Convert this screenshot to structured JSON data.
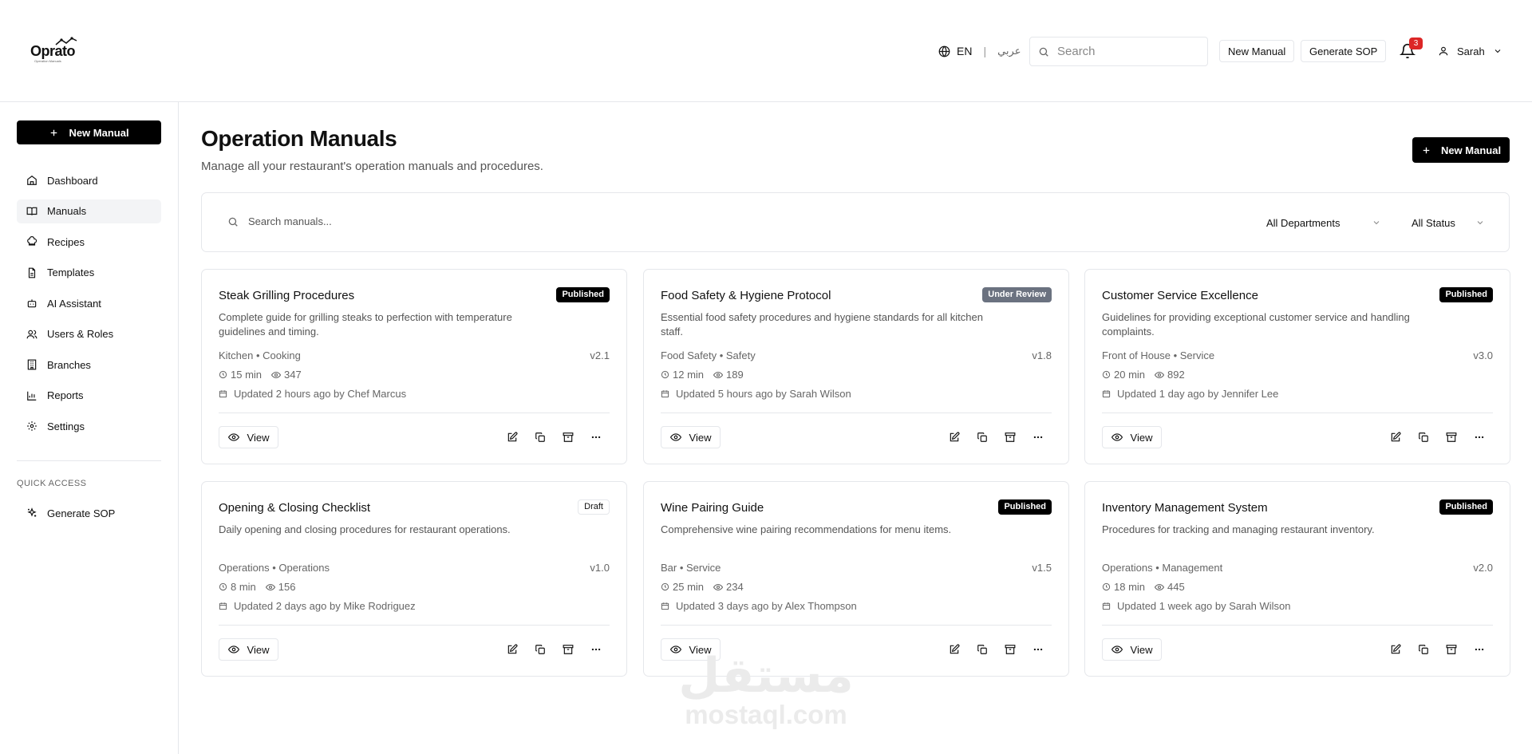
{
  "brand": {
    "name": "Oprato",
    "tagline": "Operation Manuals"
  },
  "header": {
    "lang_en": "EN",
    "lang_ar": "عربي",
    "search_placeholder": "Search",
    "new_manual_label": "New Manual",
    "generate_sop_label": "Generate SOP",
    "notification_count": "3",
    "user_name": "Sarah"
  },
  "sidebar": {
    "new_manual_label": "New Manual",
    "items": [
      {
        "label": "Dashboard",
        "icon": "home-icon"
      },
      {
        "label": "Manuals",
        "icon": "book-icon",
        "active": true
      },
      {
        "label": "Recipes",
        "icon": "chef-hat-icon"
      },
      {
        "label": "Templates",
        "icon": "file-icon"
      },
      {
        "label": "AI Assistant",
        "icon": "bot-icon"
      },
      {
        "label": "Users & Roles",
        "icon": "users-icon"
      },
      {
        "label": "Branches",
        "icon": "building-icon"
      },
      {
        "label": "Reports",
        "icon": "chart-icon"
      },
      {
        "label": "Settings",
        "icon": "gear-icon"
      }
    ],
    "quick_access_label": "QUICK ACCESS",
    "quick_items": [
      {
        "label": "Generate SOP",
        "icon": "sparkle-icon"
      }
    ]
  },
  "main": {
    "title": "Operation Manuals",
    "subtitle": "Manage all your restaurant's operation manuals and procedures.",
    "new_manual_label": "New Manual",
    "filter": {
      "search_placeholder": "Search manuals...",
      "department": "All Departments",
      "status": "All Status"
    },
    "view_label": "View",
    "cards": [
      {
        "title": "Steak Grilling Procedures",
        "status": "Published",
        "status_kind": "pub",
        "description": "Complete guide for grilling steaks to perfection with temperature guidelines and timing.",
        "category": "Kitchen • Cooking",
        "version": "v2.1",
        "duration": "15 min",
        "views": "347",
        "updated": "Updated 2 hours ago by Chef Marcus"
      },
      {
        "title": "Food Safety & Hygiene Protocol",
        "status": "Under Review",
        "status_kind": "rev",
        "description": "Essential food safety procedures and hygiene standards for all kitchen staff.",
        "category": "Food Safety • Safety",
        "version": "v1.8",
        "duration": "12 min",
        "views": "189",
        "updated": "Updated 5 hours ago by Sarah Wilson"
      },
      {
        "title": "Customer Service Excellence",
        "status": "Published",
        "status_kind": "pub",
        "description": "Guidelines for providing exceptional customer service and handling complaints.",
        "category": "Front of House • Service",
        "version": "v3.0",
        "duration": "20 min",
        "views": "892",
        "updated": "Updated 1 day ago by Jennifer Lee"
      },
      {
        "title": "Opening & Closing Checklist",
        "status": "Draft",
        "status_kind": "draft",
        "description": "Daily opening and closing procedures for restaurant operations.",
        "category": "Operations • Operations",
        "version": "v1.0",
        "duration": "8 min",
        "views": "156",
        "updated": "Updated 2 days ago by Mike Rodriguez"
      },
      {
        "title": "Wine Pairing Guide",
        "status": "Published",
        "status_kind": "pub",
        "description": "Comprehensive wine pairing recommendations for menu items.",
        "category": "Bar • Service",
        "version": "v1.5",
        "duration": "25 min",
        "views": "234",
        "updated": "Updated 3 days ago by Alex Thompson"
      },
      {
        "title": "Inventory Management System",
        "status": "Published",
        "status_kind": "pub",
        "description": "Procedures for tracking and managing restaurant inventory.",
        "category": "Operations • Management",
        "version": "v2.0",
        "duration": "18 min",
        "views": "445",
        "updated": "Updated 1 week ago by Sarah Wilson"
      }
    ]
  },
  "watermark": {
    "arabic": "مستقل",
    "latin": "mostaql.com"
  }
}
